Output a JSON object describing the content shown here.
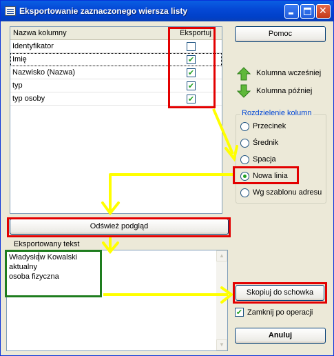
{
  "window": {
    "title": "Eksportowanie zaznaczonego wiersza listy"
  },
  "list": {
    "headers": [
      "Nazwa kolumny",
      "Eksportuj"
    ],
    "rows": [
      {
        "name": "Identyfikator",
        "checked": false
      },
      {
        "name": "Imię",
        "checked": true
      },
      {
        "name": "Nazwisko (Nazwa)",
        "checked": true
      },
      {
        "name": "typ",
        "checked": true
      },
      {
        "name": "typ osoby",
        "checked": true
      }
    ]
  },
  "buttons": {
    "help": "Pomoc",
    "refresh": "Odśwież podgląd",
    "copy": "Skopiuj do schowka",
    "cancel": "Anuluj"
  },
  "move": {
    "up": "Kolumna wcześniej",
    "down": "Kolumna później"
  },
  "separator": {
    "legend": "Rozdzielenie kolumn",
    "options": [
      "Przecinek",
      "Średnik",
      "Spacja",
      "Nowa linia",
      "Wg szablonu adresu"
    ],
    "selected": "Nowa linia"
  },
  "preview": {
    "label": "Eksportowany tekst",
    "lines": [
      "Władysław Kowalski",
      "aktualny",
      "osoba fizyczna"
    ]
  },
  "close_after": {
    "label": "Zamknij po operacji",
    "checked": true
  },
  "colors": {
    "annotation_red": "#e30000",
    "annotation_yellow": "#ffff00",
    "annotation_green": "#1e7d1e"
  }
}
